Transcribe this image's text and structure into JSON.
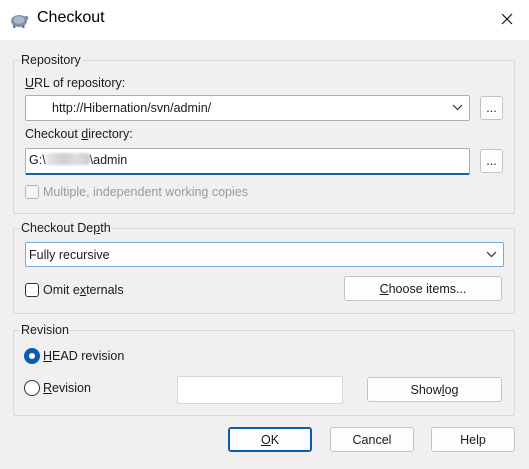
{
  "window": {
    "title": "Checkout",
    "icon": "tortoisesvn-icon"
  },
  "repository": {
    "group_label": "Repository",
    "url_label_prefix": "",
    "url_label_accel": "U",
    "url_label_rest": "RL of repository:",
    "url_value": "http://Hibernation/svn/admin/",
    "url_browse_label": "...",
    "dir_label_prefix": "Checkout ",
    "dir_label_accel": "d",
    "dir_label_rest": "irectory:",
    "dir_value_prefix": "G:\\",
    "dir_value_suffix": "\\admin",
    "dir_browse_label": "...",
    "multiple_label": "Multiple, independent working copies",
    "multiple_checked": false,
    "multiple_enabled": false
  },
  "depth": {
    "group_label_prefix": "Checkout De",
    "group_label_accel": "p",
    "group_label_rest": "th",
    "selected": "Fully recursive",
    "omit_prefix": "Omit e",
    "omit_accel": "x",
    "omit_rest": "ternals",
    "omit_checked": false,
    "choose_prefix": "",
    "choose_accel": "C",
    "choose_rest": "hoose items..."
  },
  "revision": {
    "group_label": "Revision",
    "head_accel": "H",
    "head_rest": "EAD revision",
    "head_checked": true,
    "rev_accel": "R",
    "rev_rest": "evision",
    "rev_checked": false,
    "rev_value": "",
    "showlog_prefix": "Show ",
    "showlog_accel": "l",
    "showlog_rest": "og"
  },
  "buttons": {
    "ok_accel": "O",
    "ok_rest": "K",
    "cancel_label": "Cancel",
    "help_label": "Help"
  },
  "colors": {
    "accent": "#0b5cad",
    "focus_border": "#1660b0",
    "dialog_bg": "#f0f0f0"
  }
}
